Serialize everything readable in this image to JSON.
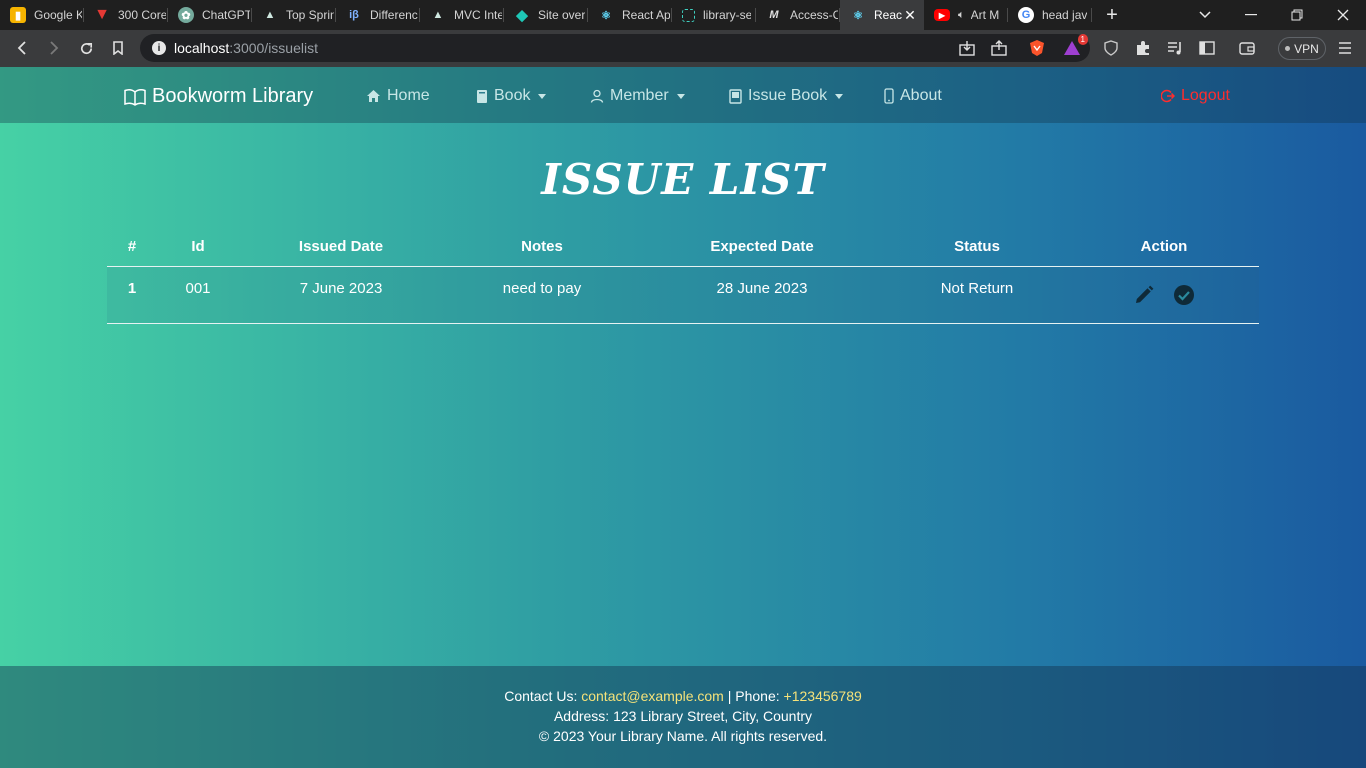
{
  "browser": {
    "tabs": [
      {
        "label": "Google K",
        "icon": "keep-icon",
        "active": false
      },
      {
        "label": "300 Core",
        "icon": "v-logo-icon",
        "active": false
      },
      {
        "label": "ChatGPT",
        "icon": "chatgpt-icon",
        "active": false
      },
      {
        "label": "Top Sprin",
        "icon": "mountain-icon",
        "active": false
      },
      {
        "label": "Differenc",
        "icon": "ib-icon",
        "active": false
      },
      {
        "label": "MVC Inte",
        "icon": "mountain-icon",
        "active": false
      },
      {
        "label": "Site over",
        "icon": "diamond-icon",
        "active": false
      },
      {
        "label": "React Ap",
        "icon": "react-icon",
        "active": false
      },
      {
        "label": "library-se",
        "icon": "dashed-square-icon",
        "active": false
      },
      {
        "label": "Access-C",
        "icon": "m-logo-icon",
        "active": false
      },
      {
        "label": "React",
        "icon": "react-icon",
        "active": true
      },
      {
        "label": "Art M",
        "icon": "youtube-icon",
        "active": false
      },
      {
        "label": "head jav",
        "icon": "google-icon",
        "active": false
      }
    ],
    "url_host": "localhost",
    "url_path": ":3000/issuelist",
    "vpn_label": "VPN",
    "notification_count": "1"
  },
  "navbar": {
    "brand": "Bookworm Library",
    "items": [
      {
        "label": "Home",
        "icon": "home-icon",
        "dropdown": false
      },
      {
        "label": "Book",
        "icon": "book-icon",
        "dropdown": true
      },
      {
        "label": "Member",
        "icon": "person-icon",
        "dropdown": true
      },
      {
        "label": "Issue Book",
        "icon": "issue-book-icon",
        "dropdown": true
      },
      {
        "label": "About",
        "icon": "phone-icon",
        "dropdown": false
      }
    ],
    "logout": "Logout"
  },
  "main": {
    "title": "ISSUE LIST",
    "table": {
      "headers": [
        "#",
        "Id",
        "Issued Date",
        "Notes",
        "Expected Date",
        "Status",
        "Action"
      ],
      "rows": [
        {
          "index": "1",
          "id": "001",
          "issued_date": "7 June 2023",
          "notes": "need to pay",
          "expected_date": "28 June 2023",
          "status": "Not Return"
        }
      ]
    }
  },
  "footer": {
    "contact_label": "Contact Us:",
    "email": "contact@example.com",
    "phone_label": "| Phone:",
    "phone": "+123456789",
    "address": "Address: 123 Library Street, City, Country",
    "copyright": "© 2023 Your Library Name. All rights reserved."
  },
  "colors": {
    "gradient_start": "#46d1a5",
    "gradient_end": "#1a5aa0",
    "logout": "#ff2d2d",
    "footer_highlight": "#f5e27a"
  }
}
